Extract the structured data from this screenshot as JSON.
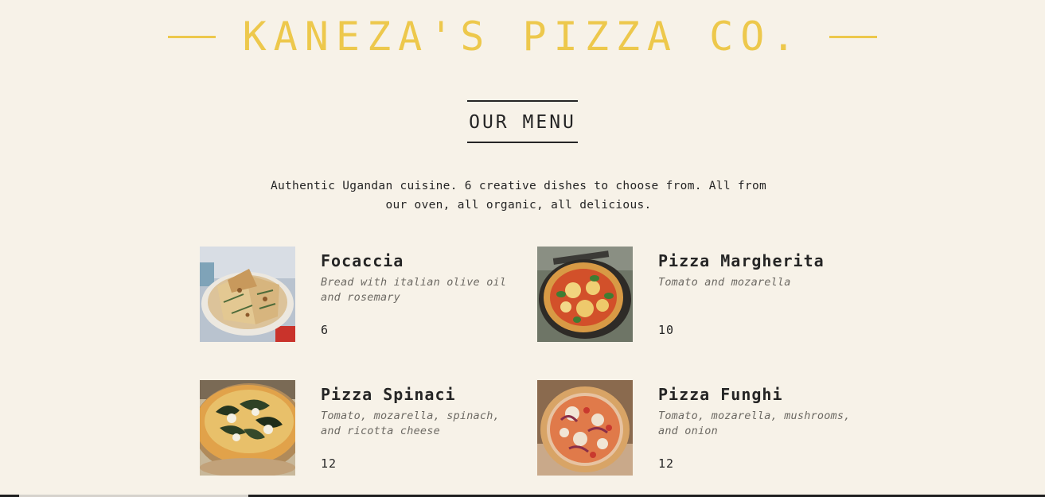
{
  "brand": {
    "title": "KANEZA'S PIZZA CO.",
    "accent_color": "#edc84c"
  },
  "menu": {
    "heading": "OUR MENU",
    "intro": "Authentic Ugandan cuisine. 6 creative dishes to choose from. All from our oven, all organic, all delicious.",
    "items": [
      {
        "name": "Focaccia",
        "description": "Bread with italian olive oil and rosemary",
        "price": "6",
        "photo": "focaccia-photo"
      },
      {
        "name": "Pizza Margherita",
        "description": "Tomato and mozarella",
        "price": "10",
        "photo": "margherita-photo"
      },
      {
        "name": "Pizza Spinaci",
        "description": "Tomato, mozarella, spinach, and ricotta cheese",
        "price": "12",
        "photo": "spinaci-photo"
      },
      {
        "name": "Pizza Funghi",
        "description": "Tomato, mozarella, mushrooms, and onion",
        "price": "12",
        "photo": "funghi-photo"
      }
    ]
  },
  "colors": {
    "background": "#f7f2e8",
    "text": "#252525",
    "muted": "#6c6963"
  }
}
